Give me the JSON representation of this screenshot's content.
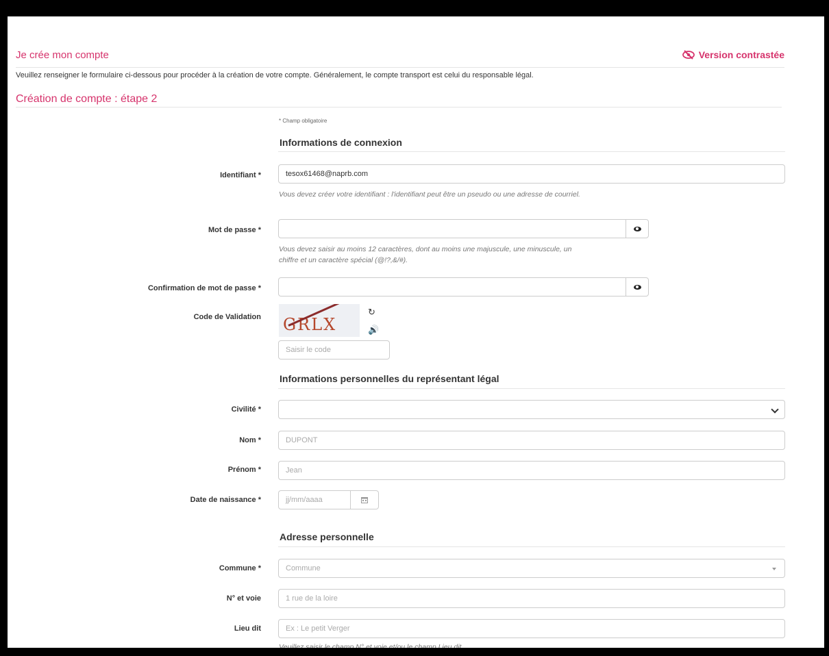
{
  "header": {
    "title": "Je crée mon compte",
    "contrast_label": "Version contrastée",
    "intro": "Veuillez renseigner le formulaire ci-dessous pour procéder à la création de votre compte. Généralement, le compte transport est celui du responsable légal.",
    "step_title": "Création de compte : étape 2",
    "required_note": "* Champ obligatoire"
  },
  "login_section": {
    "title": "Informations de connexion",
    "username_label": "Identifiant *",
    "username_value": "tesox61468@naprb.com",
    "username_help": "Vous devez créer votre identifiant : l'identifiant peut être un pseudo ou une adresse de courriel.",
    "password_label": "Mot de passe *",
    "password_value": "",
    "password_help_1": "Vous devez saisir au moins 12 caractères, dont au moins une majuscule, une minuscule, un",
    "password_help_2": "chiffre et un caractère spécial (@!?,&/#).",
    "confirm_label": "Confirmation de mot de passe *",
    "confirm_value": "",
    "captcha_label": "Code de Validation",
    "captcha_text": "GRLX",
    "captcha_placeholder": "Saisir le code"
  },
  "personal_section": {
    "title": "Informations personnelles du représentant légal",
    "civility_label": "Civilité *",
    "civility_value": "",
    "lastname_label": "Nom *",
    "lastname_placeholder": "DUPONT",
    "firstname_label": "Prénom *",
    "firstname_placeholder": "Jean",
    "birthdate_label": "Date de naissance *",
    "birthdate_placeholder": "jj/mm/aaaa"
  },
  "address_section": {
    "title": "Adresse personnelle",
    "commune_label": "Commune *",
    "commune_placeholder": "Commune",
    "street_label": "N° et voie",
    "street_placeholder": "1 rue de la loire",
    "locality_label": "Lieu dit",
    "locality_placeholder": "Ex : Le petit Verger",
    "locality_help": "Veuillez saisir le champ N° et voie et/ou le champ Lieu dit"
  },
  "colors": {
    "accent": "#d6336c",
    "frame": "#000000"
  },
  "icons": [
    "eye-slash-icon",
    "eye-icon",
    "refresh-icon",
    "audio-icon",
    "chevron-down-icon",
    "calendar-icon",
    "caret-down-icon"
  ]
}
